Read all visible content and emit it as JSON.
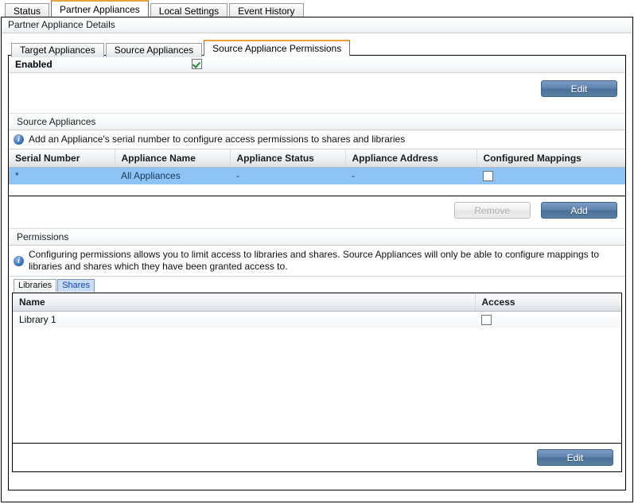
{
  "window": {
    "top_tabs": [
      {
        "label": "Status",
        "active": false
      },
      {
        "label": "Partner Appliances",
        "active": true
      },
      {
        "label": "Local Settings",
        "active": false
      },
      {
        "label": "Event History",
        "active": false
      }
    ],
    "page_title": "Partner Appliance Details"
  },
  "inner_tabs": [
    {
      "label": "Target Appliances",
      "active": false
    },
    {
      "label": "Source Appliances",
      "active": false
    },
    {
      "label": "Source Appliance Permissions",
      "active": true
    }
  ],
  "enabled_row": {
    "label": "Enabled",
    "checkbox_state": "checked",
    "checkbox_name": "enabled-checkbox"
  },
  "top_edit_button": {
    "label": "Edit",
    "state": "enabled"
  },
  "source_appliances": {
    "section_title": "Source Appliances",
    "info_text": "Add an Appliance's serial number to configure access permissions to shares and libraries",
    "columns": [
      "Serial Number",
      "Appliance Name",
      "Appliance Status",
      "Appliance Address",
      "Configured Mappings"
    ],
    "rows": [
      {
        "serial_number": "*",
        "appliance_name": "All Appliances",
        "appliance_status": "-",
        "appliance_address": "-",
        "configured_mappings": "unchecked",
        "selected": true
      }
    ],
    "remove_button": {
      "label": "Remove",
      "state": "disabled"
    },
    "add_button": {
      "label": "Add",
      "state": "enabled"
    }
  },
  "permissions": {
    "section_title": "Permissions",
    "info_text": "Configuring permissions allows you to limit access to libraries and shares. Source Appliances will only be able to configure mappings to libraries and shares which they have been granted access to.",
    "sub_tabs": [
      {
        "label": "Libraries",
        "selected": false
      },
      {
        "label": "Shares",
        "selected": true
      }
    ],
    "columns": [
      "Name",
      "Access"
    ],
    "rows": [
      {
        "name": "Library 1",
        "access": "unchecked"
      }
    ],
    "bottom_edit_button": {
      "label": "Edit",
      "state": "enabled"
    }
  },
  "colors": {
    "tab_active_accent": "#e8a33d",
    "row_selected": "#8ec3f5",
    "button_blue": "#5d82ad",
    "info_icon_blue": "#3f73b8",
    "check_green": "#1f8a2a",
    "subtab_selected_text": "#1247a5"
  }
}
